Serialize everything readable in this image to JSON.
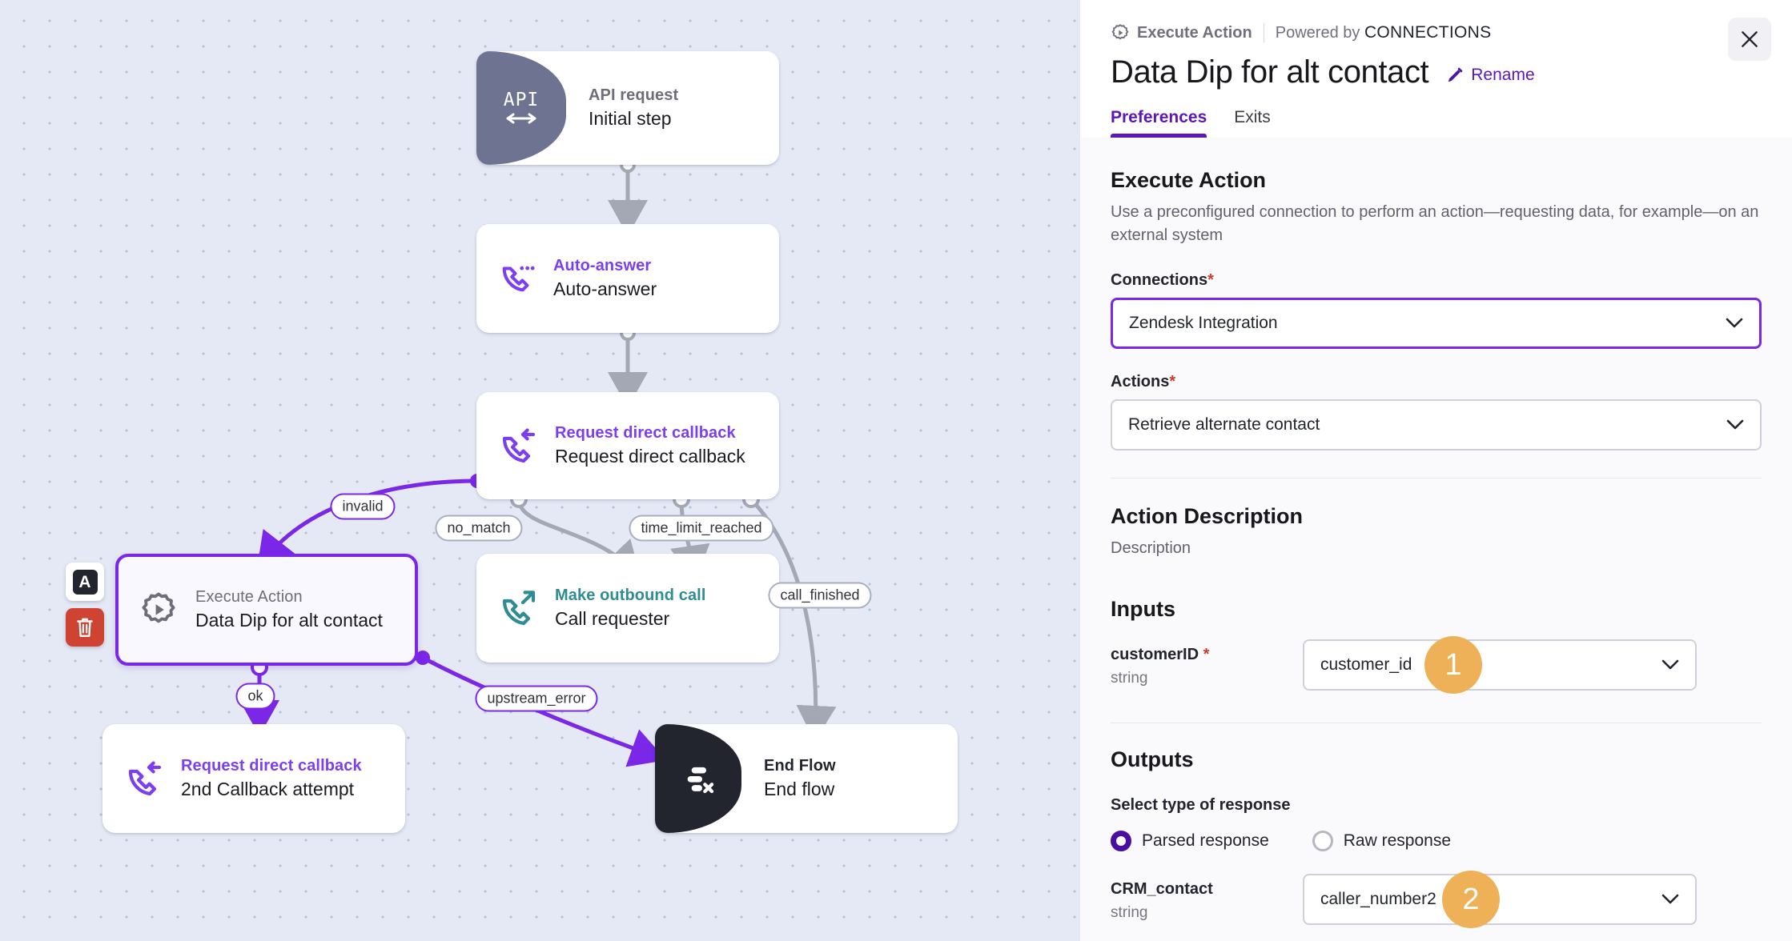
{
  "canvas": {
    "nodes": [
      {
        "id": "api",
        "kind": "API request",
        "name": "Initial step",
        "icon": "api-arrows-icon",
        "cap_text": "API"
      },
      {
        "id": "auto",
        "kind": "Auto-answer",
        "name": "Auto-answer",
        "icon": "phone-dots-icon"
      },
      {
        "id": "reqcb",
        "kind": "Request direct callback",
        "name": "Request direct callback",
        "icon": "phone-callback-icon"
      },
      {
        "id": "exec",
        "kind": "Execute Action",
        "name": "Data Dip for alt contact",
        "icon": "gear-play-icon"
      },
      {
        "id": "outbound",
        "kind": "Make outbound call",
        "name": "Call requester",
        "icon": "phone-outbound-icon"
      },
      {
        "id": "cb2",
        "kind": "Request direct callback",
        "name": "2nd Callback attempt",
        "icon": "phone-callback-icon"
      },
      {
        "id": "end",
        "kind": "End Flow",
        "name": "End flow",
        "icon": "end-flow-icon"
      }
    ],
    "edge_labels": [
      {
        "id": "invalid",
        "text": "invalid"
      },
      {
        "id": "no_match",
        "text": "no_match"
      },
      {
        "id": "time_limit",
        "text": "time_limit_reached"
      },
      {
        "id": "call_finished",
        "text": "call_finished"
      },
      {
        "id": "ok",
        "text": "ok"
      },
      {
        "id": "upstream_error",
        "text": "upstream_error"
      }
    ],
    "selected_tools": [
      {
        "id": "annotate",
        "icon": "letter-a-icon",
        "label": "A"
      },
      {
        "id": "delete",
        "icon": "trash-icon"
      }
    ],
    "colors": {
      "accent_purple": "#7b27e8",
      "teal": "#2f8c93",
      "grey_node": "#6e7391",
      "dark_node": "#22242e",
      "danger": "#cf4333"
    }
  },
  "panel": {
    "breadcrumb": {
      "step_type": "Execute Action",
      "powered_prefix": "Powered by",
      "powered_brand": "CONNECTIONS"
    },
    "title": "Data Dip for alt contact",
    "rename_label": "Rename",
    "close_icon": "close-icon",
    "tabs": [
      {
        "id": "preferences",
        "label": "Preferences",
        "active": true
      },
      {
        "id": "exits",
        "label": "Exits",
        "active": false
      }
    ],
    "execute_action": {
      "heading": "Execute Action",
      "description": "Use a preconfigured connection to perform an action—requesting data, for example—on an external system"
    },
    "connections": {
      "label": "Connections",
      "required": "*",
      "value": "Zendesk Integration",
      "chevron": "chevron-down-icon"
    },
    "actions": {
      "label": "Actions",
      "required": "*",
      "value": "Retrieve alternate contact",
      "chevron": "chevron-down-icon"
    },
    "action_description": {
      "heading": "Action Description",
      "text": "Description"
    },
    "inputs": {
      "heading": "Inputs",
      "rows": [
        {
          "name": "customerID",
          "required": "*",
          "type": "string",
          "value": "customer_id",
          "badge": "1"
        }
      ]
    },
    "outputs": {
      "heading": "Outputs",
      "response_type_label": "Select type of response",
      "options": [
        {
          "id": "parsed",
          "label": "Parsed response",
          "selected": true
        },
        {
          "id": "raw",
          "label": "Raw response",
          "selected": false
        }
      ],
      "rows": [
        {
          "name": "CRM_contact",
          "required": "",
          "type": "string",
          "value": "caller_number2",
          "badge": "2"
        }
      ]
    }
  }
}
